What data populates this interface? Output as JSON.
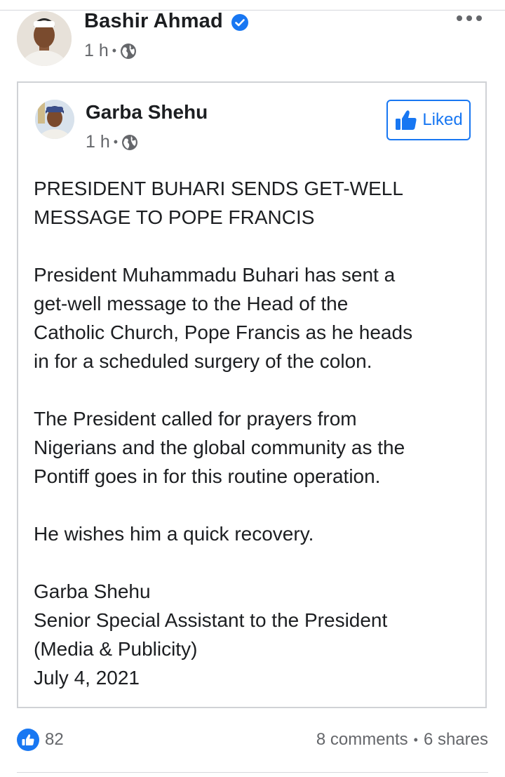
{
  "post": {
    "author": "Bashir Ahmad",
    "verified_icon": "verified-badge-icon",
    "time": "1 h",
    "privacy_icon": "globe-icon",
    "more_icon": "more-options-icon"
  },
  "shared_post": {
    "author": "Garba Shehu",
    "time": "1 h",
    "privacy_icon": "globe-icon",
    "like_button_label": "Liked",
    "like_button_icon": "thumbs-up-icon",
    "paragraphs": [
      "PRESIDENT BUHARI SENDS GET-WELL\nMESSAGE TO POPE FRANCIS",
      "President Muhammadu Buhari has sent a\nget-well message to the Head of the\nCatholic Church, Pope Francis as he heads\nin for a scheduled surgery of the colon.",
      "The President called for prayers from\nNigerians and the global community as the\nPontiff goes in for this routine operation.",
      "He wishes him a quick recovery.",
      "Garba Shehu\nSenior Special Assistant to the President\n(Media & Publicity)\nJuly 4, 2021"
    ]
  },
  "footer": {
    "reaction_count": "82",
    "comments": "8 comments",
    "shares": "6 shares"
  },
  "colors": {
    "accent": "#1877f2",
    "text": "#1c1e21",
    "secondary_text": "#65676b",
    "border": "#d0d2d6"
  }
}
